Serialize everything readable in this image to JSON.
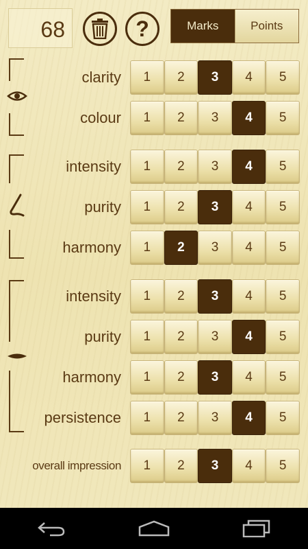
{
  "header": {
    "score": "68",
    "trash_icon": "trash-icon",
    "help_label": "?",
    "modes": [
      {
        "label": "Marks",
        "active": true
      },
      {
        "label": "Points",
        "active": false
      }
    ]
  },
  "scale": [
    "1",
    "2",
    "3",
    "4",
    "5"
  ],
  "sections": [
    {
      "icon": "eye-icon",
      "rows": [
        {
          "label": "clarity",
          "selected": 3
        },
        {
          "label": "colour",
          "selected": 4
        }
      ]
    },
    {
      "icon": "nose-icon",
      "rows": [
        {
          "label": "intensity",
          "selected": 4
        },
        {
          "label": "purity",
          "selected": 3
        },
        {
          "label": "harmony",
          "selected": 2
        }
      ]
    },
    {
      "icon": "mouth-icon",
      "rows": [
        {
          "label": "intensity",
          "selected": 3
        },
        {
          "label": "purity",
          "selected": 4
        },
        {
          "label": "harmony",
          "selected": 3
        },
        {
          "label": "persistence",
          "selected": 4
        }
      ]
    },
    {
      "icon": "",
      "rows": [
        {
          "label": "overall impression",
          "selected": 3
        }
      ]
    }
  ],
  "navbar": [
    "back-icon",
    "home-icon",
    "recent-apps-icon"
  ]
}
